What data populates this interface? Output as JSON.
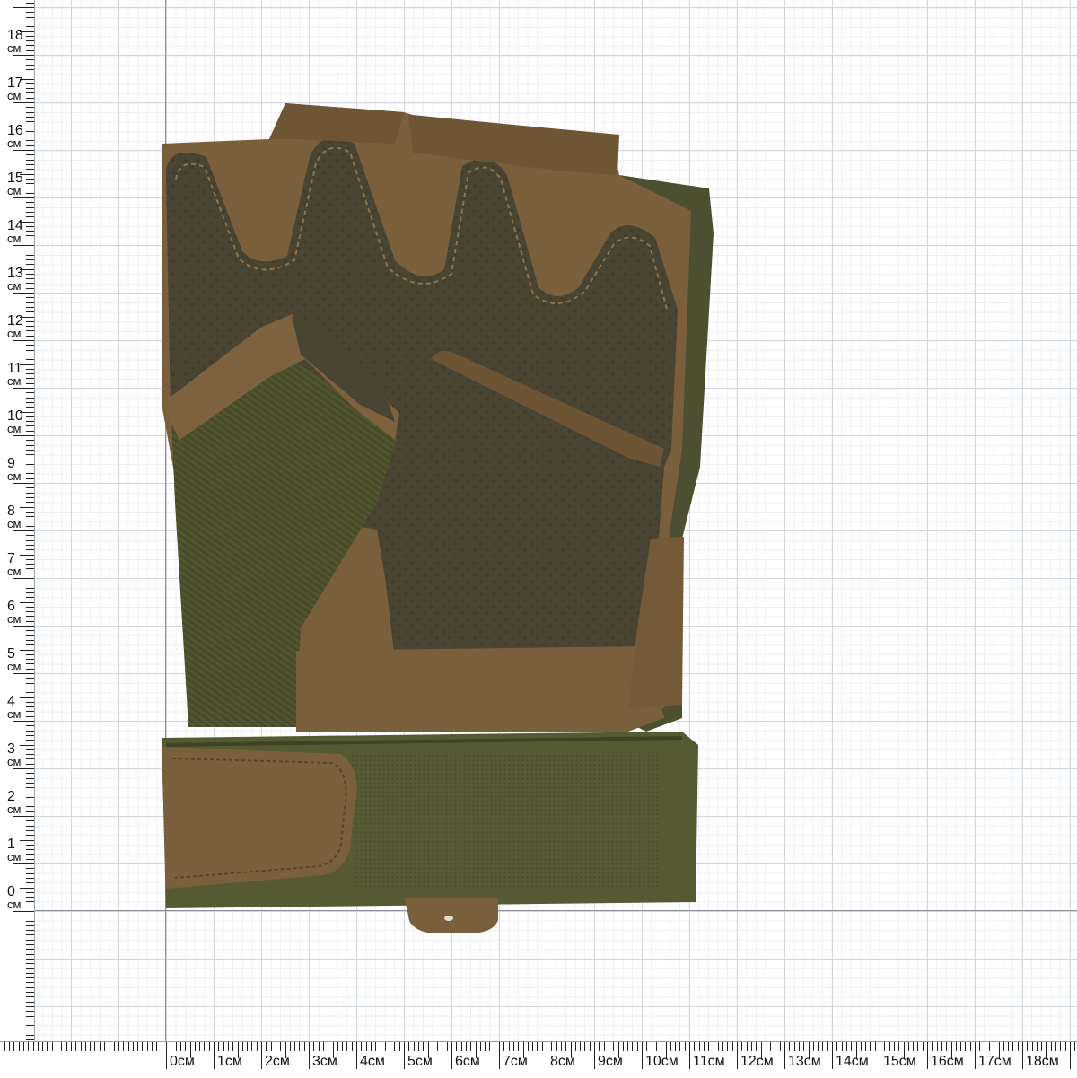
{
  "ruler": {
    "unit": "см",
    "vertical_labels": [
      "0",
      "1",
      "2",
      "3",
      "4",
      "5",
      "6",
      "7",
      "8",
      "9",
      "10",
      "11",
      "12",
      "13",
      "14",
      "15",
      "16",
      "17",
      "18"
    ],
    "horizontal_labels": [
      "0см",
      "1см",
      "2см",
      "3см",
      "4см",
      "5см",
      "6см",
      "7см",
      "8см",
      "9см",
      "10см",
      "11см",
      "12см",
      "13см",
      "14см",
      "15см",
      "16см",
      "17см",
      "18см"
    ]
  },
  "photo": {
    "subject": "fingerless tactical glove",
    "colors": {
      "palm_leather": "#4a4432",
      "suede": "#7a5f3c",
      "knit_fabric": "#4b4f2c",
      "strap": "#555a33",
      "grid_major": "#d2d6de",
      "axis": "#8a8f99"
    }
  }
}
